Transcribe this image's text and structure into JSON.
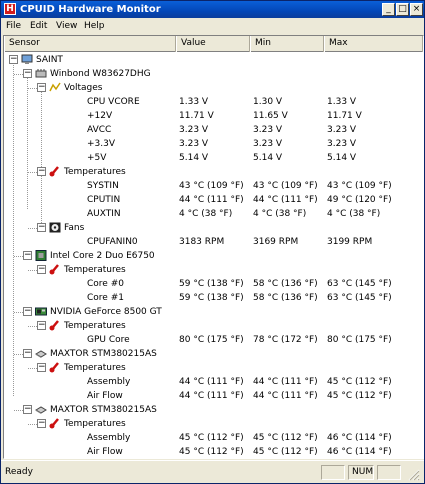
{
  "window": {
    "title": "CPUID Hardware Monitor",
    "app_icon_letter": "H"
  },
  "titlebar_buttons": {
    "minimize": "_",
    "maximize": "□",
    "close": "×"
  },
  "menu": [
    "File",
    "Edit",
    "View",
    "Help"
  ],
  "columns": {
    "sensor": "Sensor",
    "value": "Value",
    "min": "Min",
    "max": "Max"
  },
  "tree": {
    "computer": "SAINT",
    "winbond": {
      "name": "Winbond W83627DHG",
      "voltages_label": "Voltages",
      "voltages": [
        {
          "name": "CPU VCORE",
          "value": "1.33 V",
          "min": "1.30 V",
          "max": "1.33 V"
        },
        {
          "name": "+12V",
          "value": "11.71 V",
          "min": "11.65 V",
          "max": "11.71 V"
        },
        {
          "name": "AVCC",
          "value": "3.23 V",
          "min": "3.23 V",
          "max": "3.23 V"
        },
        {
          "name": "+3.3V",
          "value": "3.23 V",
          "min": "3.23 V",
          "max": "3.23 V"
        },
        {
          "name": "+5V",
          "value": "5.14 V",
          "min": "5.14 V",
          "max": "5.14 V"
        }
      ],
      "temperatures_label": "Temperatures",
      "temperatures": [
        {
          "name": "SYSTIN",
          "value": "43 °C  (109 °F)",
          "min": "43 °C  (109 °F)",
          "max": "43 °C  (109 °F)"
        },
        {
          "name": "CPUTIN",
          "value": "44 °C  (111 °F)",
          "min": "44 °C  (111 °F)",
          "max": "49 °C  (120 °F)"
        },
        {
          "name": "AUXTIN",
          "value": "4 °C  (38 °F)",
          "min": "4 °C  (38 °F)",
          "max": "4 °C  (38 °F)"
        }
      ],
      "fans_label": "Fans",
      "fans": [
        {
          "name": "CPUFANIN0",
          "value": "3183 RPM",
          "min": "3169 RPM",
          "max": "3199 RPM"
        }
      ]
    },
    "cpu": {
      "name": "Intel Core 2 Duo E6750",
      "temperatures_label": "Temperatures",
      "temperatures": [
        {
          "name": "Core #0",
          "value": "59 °C  (138 °F)",
          "min": "58 °C  (136 °F)",
          "max": "63 °C  (145 °F)"
        },
        {
          "name": "Core #1",
          "value": "59 °C  (138 °F)",
          "min": "58 °C  (136 °F)",
          "max": "63 °C  (145 °F)"
        }
      ]
    },
    "gpu": {
      "name": "NVIDIA GeForce 8500 GT",
      "temperatures_label": "Temperatures",
      "temperatures": [
        {
          "name": "GPU Core",
          "value": "80 °C  (175 °F)",
          "min": "78 °C  (172 °F)",
          "max": "80 °C  (175 °F)"
        }
      ]
    },
    "hdd1": {
      "name": "MAXTOR STM380215AS",
      "temperatures_label": "Temperatures",
      "temperatures": [
        {
          "name": "Assembly",
          "value": "44 °C  (111 °F)",
          "min": "44 °C  (111 °F)",
          "max": "45 °C  (112 °F)"
        },
        {
          "name": "Air Flow",
          "value": "44 °C  (111 °F)",
          "min": "44 °C  (111 °F)",
          "max": "45 °C  (112 °F)"
        }
      ]
    },
    "hdd2": {
      "name": "MAXTOR STM380215AS",
      "temperatures_label": "Temperatures",
      "temperatures": [
        {
          "name": "Assembly",
          "value": "45 °C  (112 °F)",
          "min": "45 °C  (112 °F)",
          "max": "46 °C  (114 °F)"
        },
        {
          "name": "Air Flow",
          "value": "45 °C  (112 °F)",
          "min": "45 °C  (112 °F)",
          "max": "46 °C  (114 °F)"
        }
      ]
    }
  },
  "statusbar": {
    "text": "Ready",
    "num": "NUM"
  },
  "colors": {
    "title_bar": "#0347b8",
    "chrome": "#ece9d8",
    "icon_red": "#d21c1c"
  }
}
